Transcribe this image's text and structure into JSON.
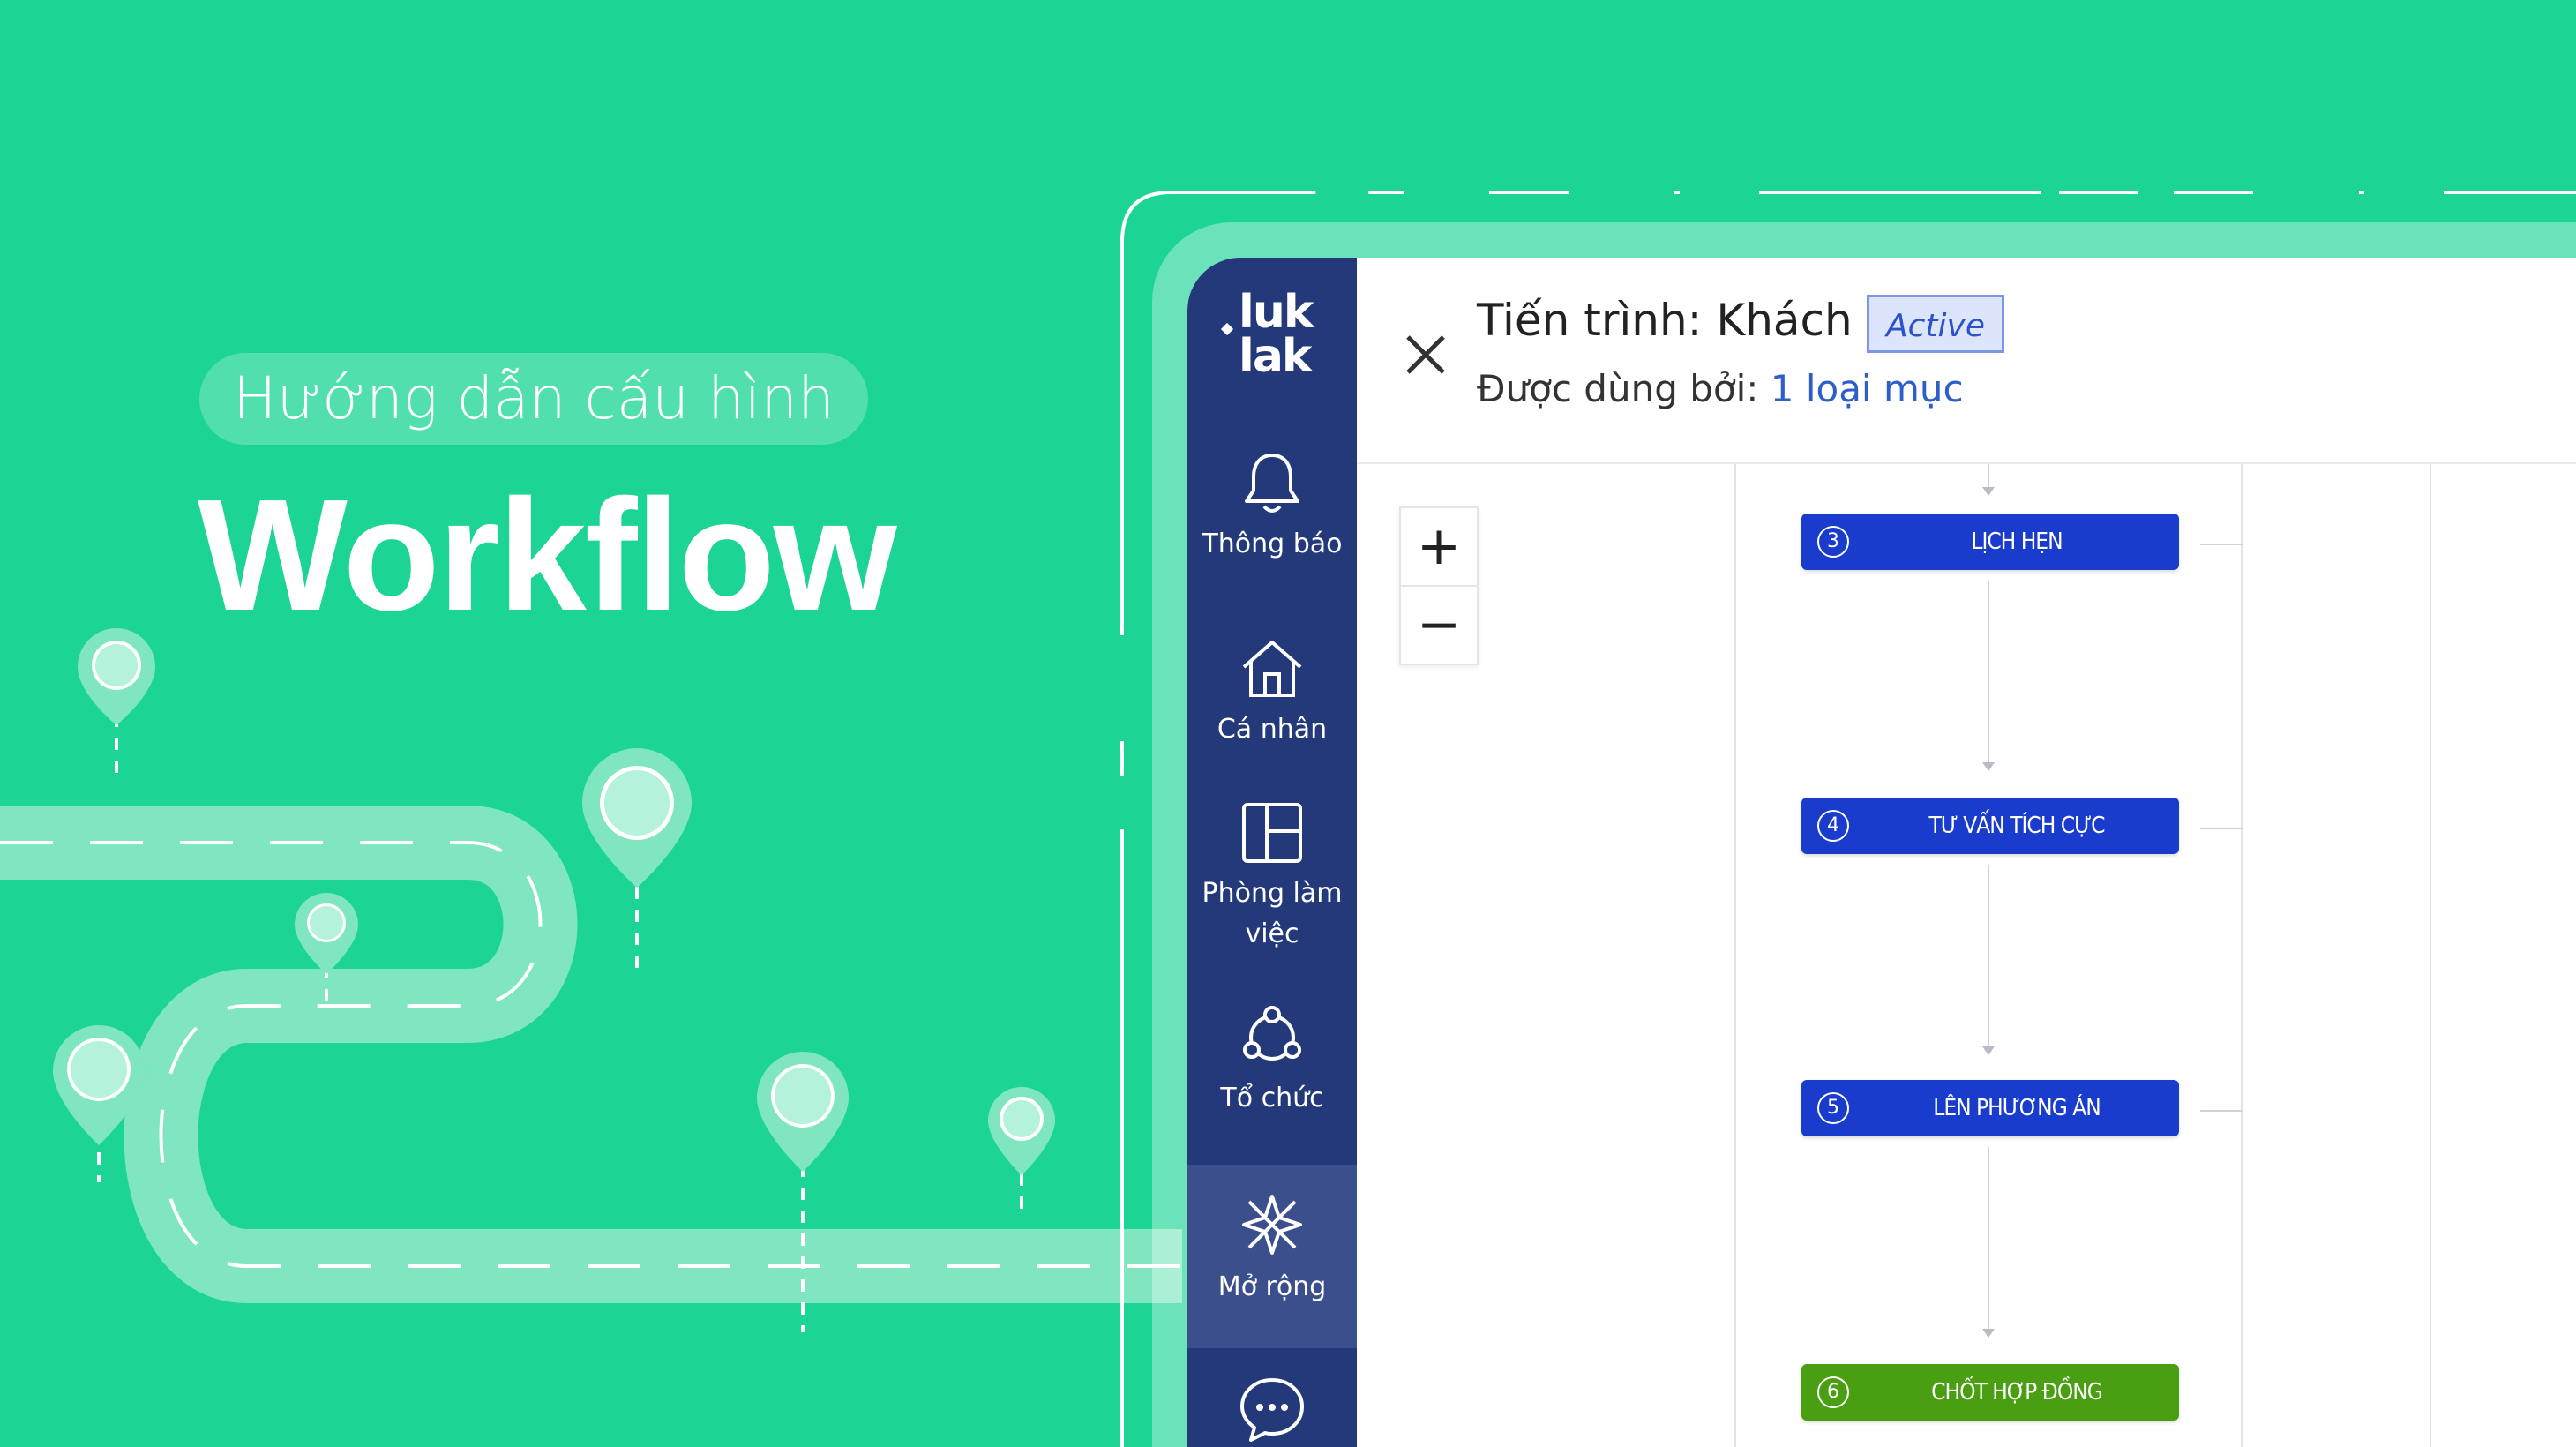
{
  "hero": {
    "subtitle": "Hướng dẫn cấu hình",
    "title": "Workflow"
  },
  "colors": {
    "background": "#1cd595",
    "sidebar": "#23397a",
    "sidebar_active": "#3b4f8c",
    "step_blue": "#1a3ccc",
    "step_green": "#4a9e12",
    "link": "#2e5ec7"
  },
  "sidebar": {
    "logo_line1": "luk",
    "logo_line2": "lak",
    "items": [
      {
        "label": "Thông báo",
        "icon": "bell-icon"
      },
      {
        "label": "Cá nhân",
        "icon": "home-icon"
      },
      {
        "label": "Phòng làm việc",
        "icon": "layout-icon"
      },
      {
        "label": "Tổ chức",
        "icon": "organization-icon"
      },
      {
        "label": "Mở rộng",
        "icon": "extend-icon",
        "active": true
      },
      {
        "label": "",
        "icon": "chat-icon"
      }
    ]
  },
  "header": {
    "title": "Tiến trình: Khách hàng",
    "status_badge": "Active",
    "used_by_label": "Được dùng bởi:",
    "used_by_link": "1 loại mục"
  },
  "zoom": {
    "in_label": "+",
    "out_label": "−"
  },
  "steps": [
    {
      "number": "3",
      "label": "LỊCH HẸN",
      "color": "#1a3ccc"
    },
    {
      "number": "4",
      "label": "TƯ VẤN TÍCH CỰC",
      "color": "#1a3ccc"
    },
    {
      "number": "5",
      "label": "LÊN PHƯƠNG ÁN",
      "color": "#1a3ccc"
    },
    {
      "number": "6",
      "label": "CHỐT HỢP ĐỒNG",
      "color": "#4a9e12"
    }
  ]
}
